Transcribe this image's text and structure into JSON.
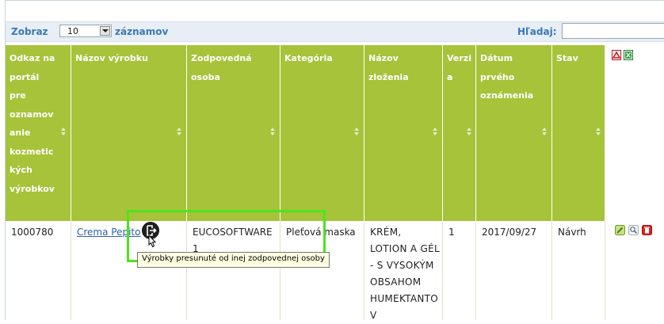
{
  "toolbar": {
    "show_label": "Zobraz",
    "page_length": "10",
    "records_label": "záznamov",
    "search_label": "Hľadaj:",
    "search_value": ""
  },
  "table": {
    "headers": [
      "Odkaz na\nportál\npre\noznamov\nanie\nkozmetic\nkých\nvýrobkov",
      "Názov výrobku",
      "Zodpovedná\nosoba",
      "Kategória",
      "Názov\nzloženia",
      "Verzi\na",
      "Dátum\nprvého\noznámenia",
      "Stav"
    ],
    "row": {
      "portal_id": "1000780",
      "product_name": "Crema Pepito",
      "responsible_person": "EUCOSOFTWARE\n1",
      "category": "Pleťová maska",
      "formulation": "KRÉM,\nLOTION A GÉL\n- S VYSOKÝM\nOBSAHOM\nHUMEKTANTO\nV",
      "version": "1",
      "date": "2017/09/27",
      "status": "Návrh"
    }
  },
  "tooltip": {
    "text": "Výrobky presunuté od inej zodpovednej osoby"
  },
  "icons": {
    "export": [
      "pdf-export-icon",
      "excel-export-icon"
    ],
    "row_actions": [
      "edit-icon",
      "view-icon",
      "delete-icon"
    ],
    "moved": "moved-product-icon"
  },
  "colors": {
    "header_bg": "#a6c33a",
    "highlight": "#4ee31c",
    "link": "#2e62a8",
    "toolbar_label": "#3a78b6"
  }
}
